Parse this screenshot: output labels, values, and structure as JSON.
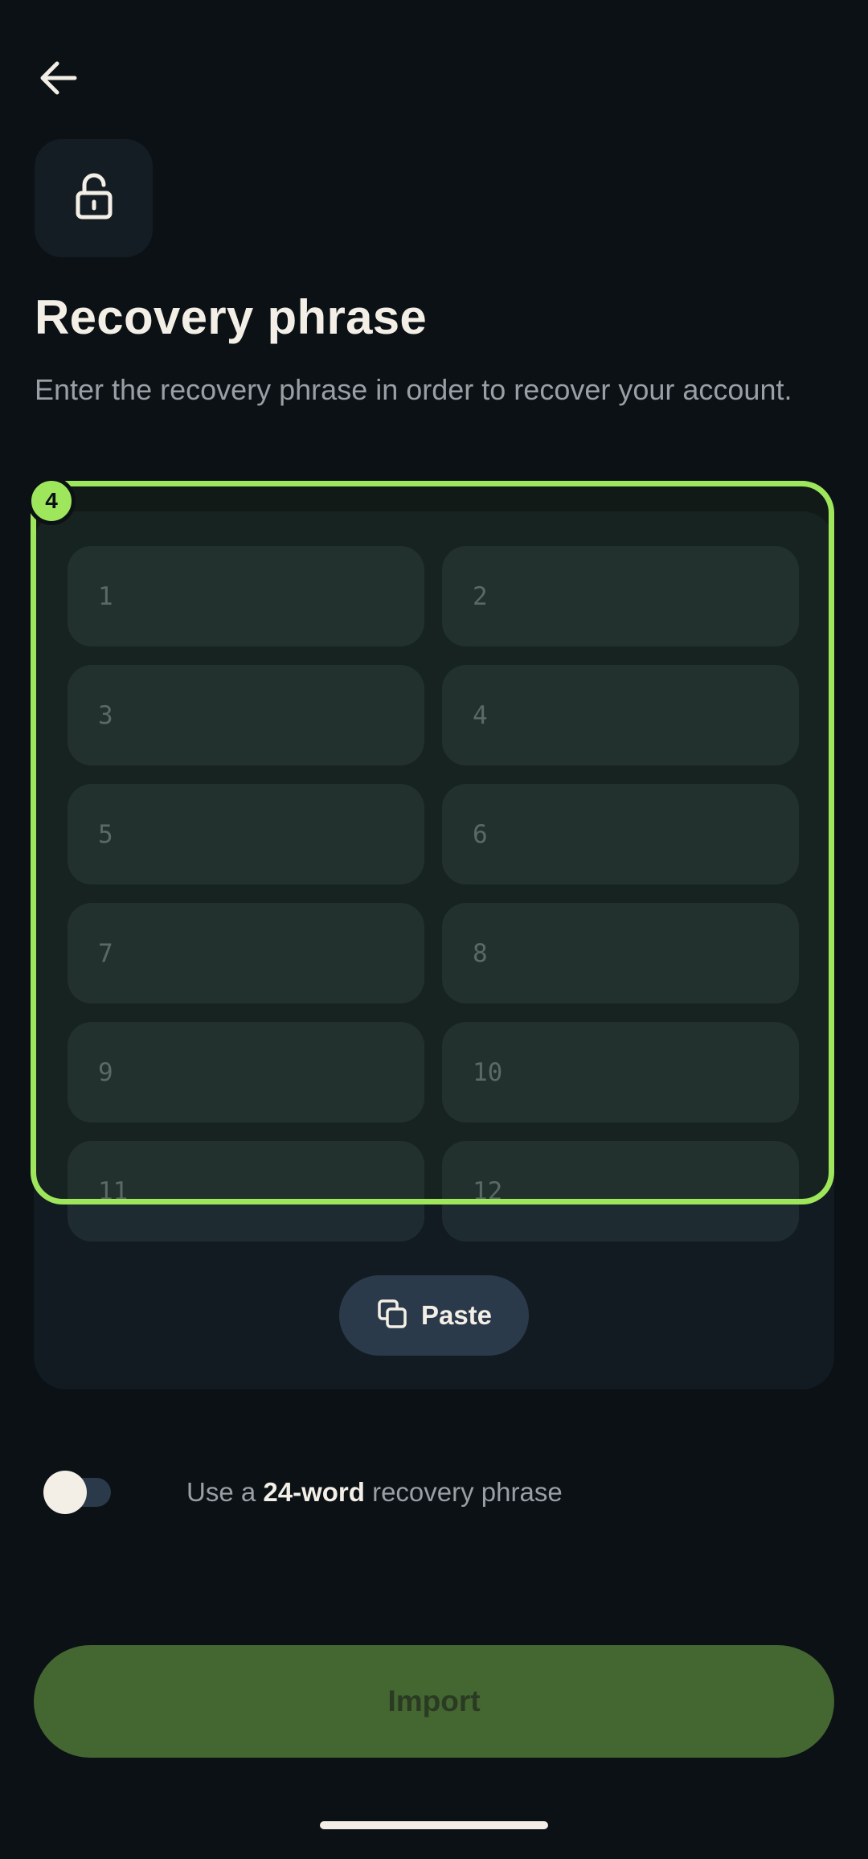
{
  "header": {
    "back_icon": "arrow-left-icon",
    "lock_icon": "lock-icon"
  },
  "title": "Recovery phrase",
  "subtitle": "Enter the recovery phrase in order to recover your account.",
  "phrase": {
    "word_placeholders": [
      "1",
      "2",
      "3",
      "4",
      "5",
      "6",
      "7",
      "8",
      "9",
      "10",
      "11",
      "12"
    ],
    "paste_label": "Paste",
    "paste_icon": "copy-icon"
  },
  "focus_badge": "4",
  "toggle": {
    "text_before": "Use a",
    "text_bold": "24-word",
    "text_after": "recovery phrase",
    "checked": false
  },
  "import_label": "Import",
  "colors": {
    "background": "#0b1115",
    "accent": "#9ee65b",
    "import_button": "#446631",
    "field": "#1e2b30",
    "card": "#121b21"
  }
}
